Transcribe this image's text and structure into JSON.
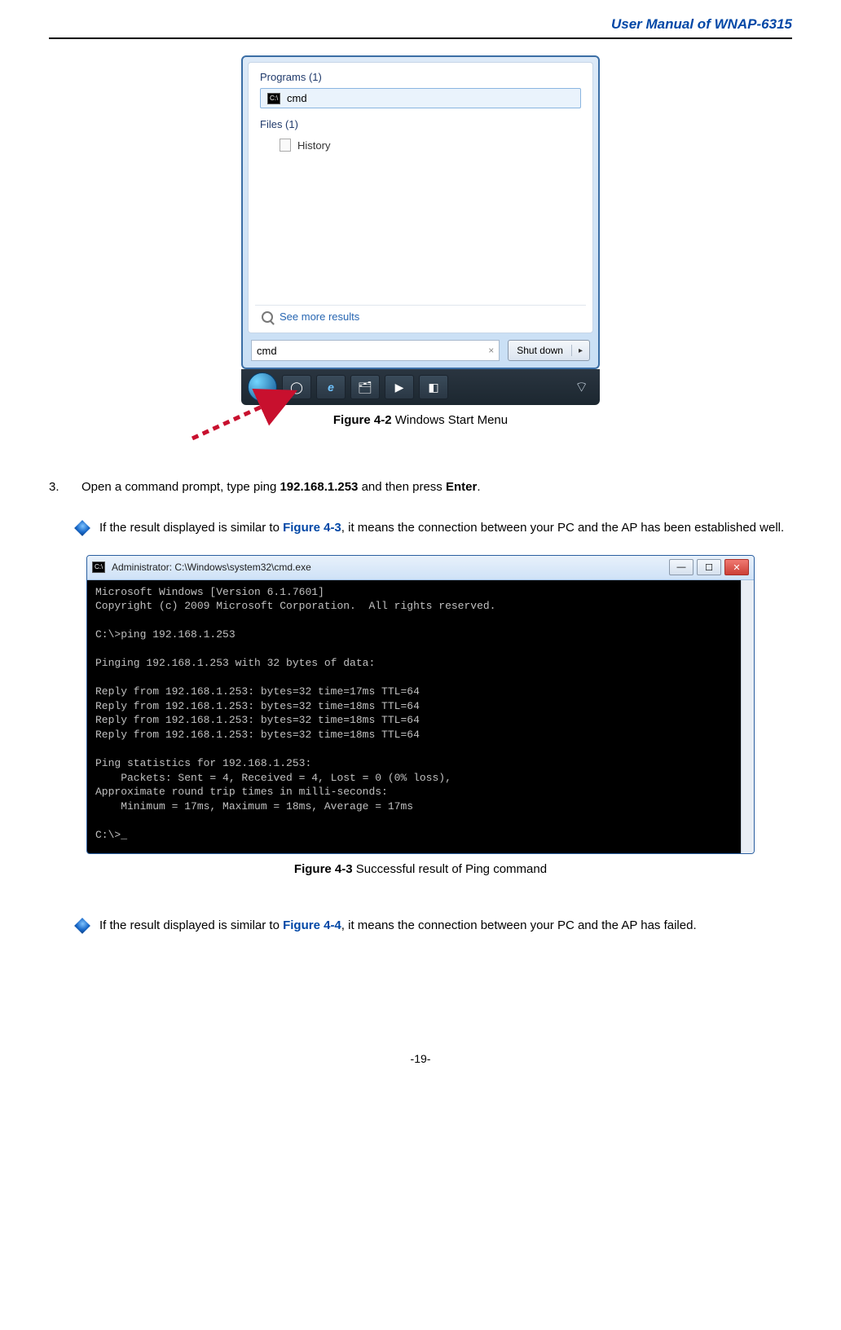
{
  "header": {
    "title": "User Manual of WNAP-6315"
  },
  "start_menu": {
    "programs_header": "Programs (1)",
    "program_item": "cmd",
    "files_header": "Files (1)",
    "file_item": "History",
    "see_more": "See more results",
    "search_value": "cmd",
    "shutdown_label": "Shut down"
  },
  "captions": {
    "fig42_ref": "Figure 4-2",
    "fig42_text": " Windows Start Menu",
    "fig43_ref": "Figure 4-3",
    "fig43_text": " Successful result of Ping command"
  },
  "step3": {
    "num": "3.",
    "text_a": "Open a command prompt, type ping ",
    "ip_bold": "192.168.1.253",
    "text_b": " and then press ",
    "enter_bold": "Enter",
    "text_c": "."
  },
  "bullet1": {
    "a": "If the result displayed is similar to ",
    "ref": "Figure 4-3",
    "b": ", it means the connection between your PC and the AP has been established well."
  },
  "bullet2": {
    "a": "If the result displayed is similar to ",
    "ref": "Figure 4-4",
    "b": ", it means the connection between your PC and the AP has failed."
  },
  "cmd": {
    "title": "Administrator: C:\\Windows\\system32\\cmd.exe",
    "body": "Microsoft Windows [Version 6.1.7601]\nCopyright (c) 2009 Microsoft Corporation.  All rights reserved.\n\nC:\\>ping 192.168.1.253\n\nPinging 192.168.1.253 with 32 bytes of data:\n\nReply from 192.168.1.253: bytes=32 time=17ms TTL=64\nReply from 192.168.1.253: bytes=32 time=18ms TTL=64\nReply from 192.168.1.253: bytes=32 time=18ms TTL=64\nReply from 192.168.1.253: bytes=32 time=18ms TTL=64\n\nPing statistics for 192.168.1.253:\n    Packets: Sent = 4, Received = 4, Lost = 0 (0% loss),\nApproximate round trip times in milli-seconds:\n    Minimum = 17ms, Maximum = 18ms, Average = 17ms\n\nC:\\>_"
  },
  "page_number": "-19-"
}
